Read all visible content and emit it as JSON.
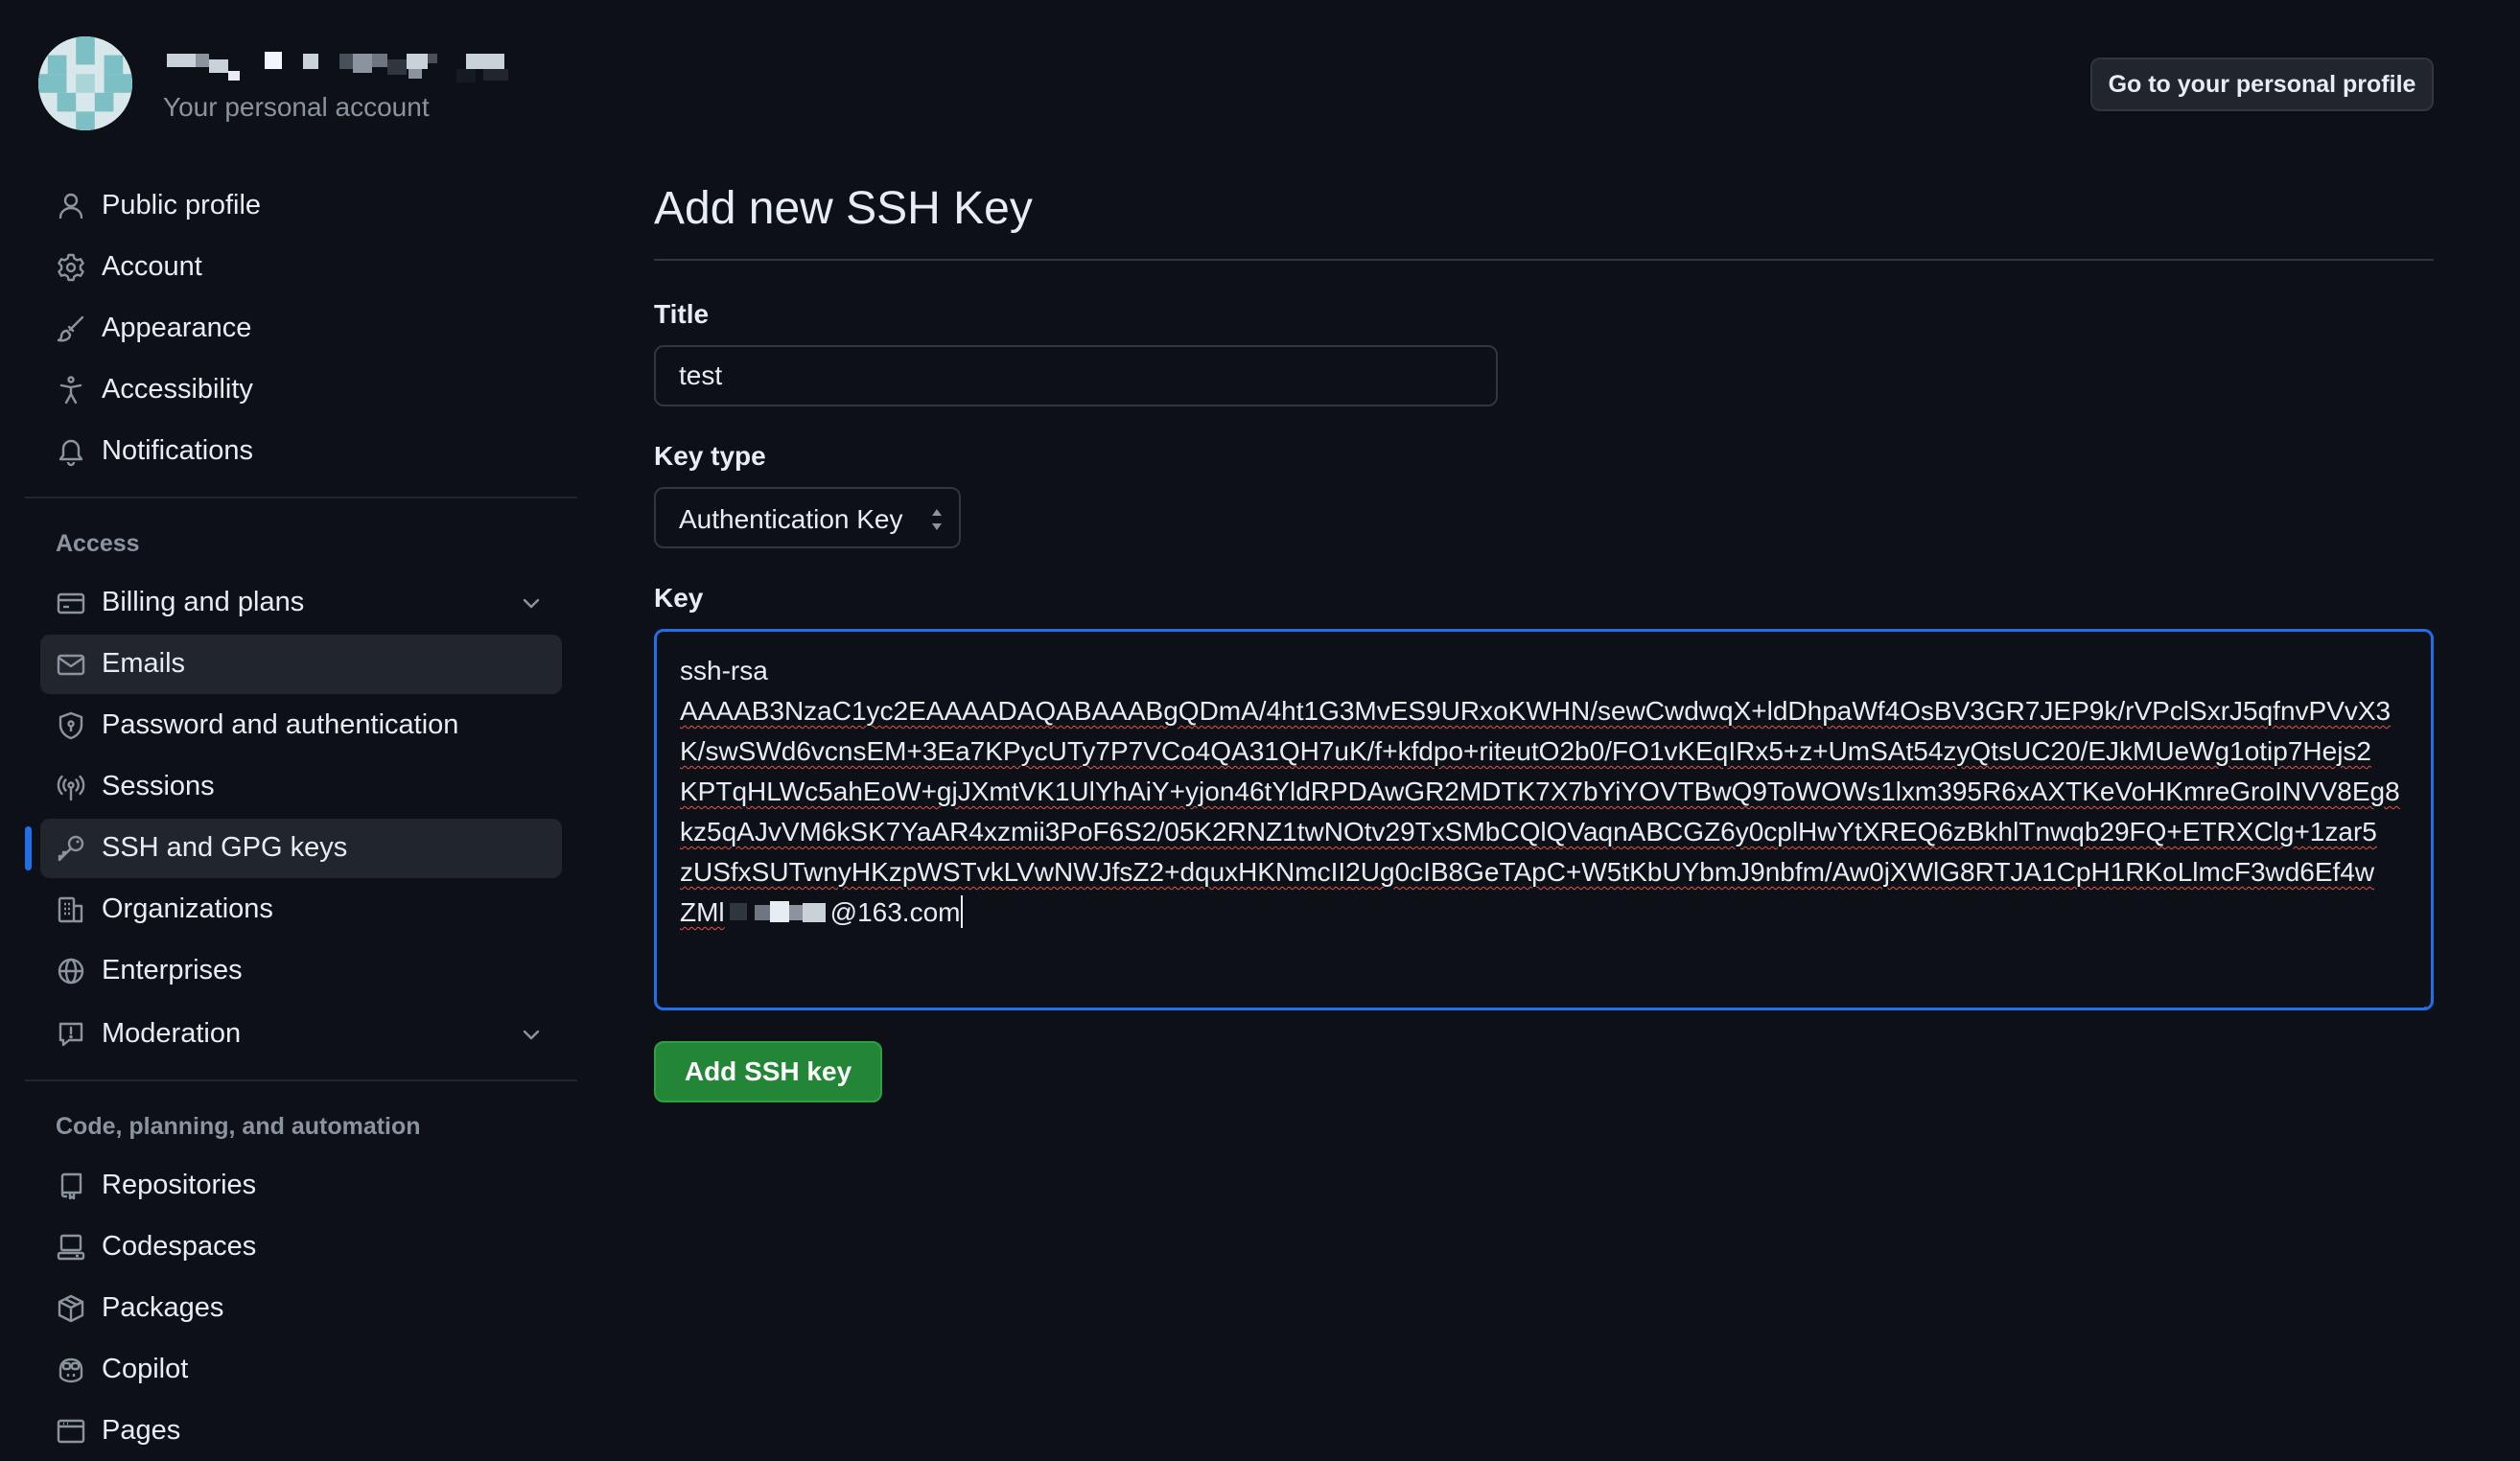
{
  "header": {
    "account_subtitle": "Your personal account",
    "profile_button": "Go to your personal profile"
  },
  "sidebar": {
    "items_top": [
      {
        "label": "Public profile",
        "icon": "person-icon"
      },
      {
        "label": "Account",
        "icon": "gear-icon"
      },
      {
        "label": "Appearance",
        "icon": "paintbrush-icon"
      },
      {
        "label": "Accessibility",
        "icon": "accessibility-icon"
      },
      {
        "label": "Notifications",
        "icon": "bell-icon"
      }
    ],
    "access_title": "Access",
    "access_items": [
      {
        "label": "Billing and plans",
        "icon": "credit-card-icon",
        "expandable": true
      },
      {
        "label": "Emails",
        "icon": "mail-icon"
      },
      {
        "label": "Password and authentication",
        "icon": "shield-lock-icon"
      },
      {
        "label": "Sessions",
        "icon": "broadcast-icon"
      },
      {
        "label": "SSH and GPG keys",
        "icon": "key-icon",
        "current": true
      },
      {
        "label": "Organizations",
        "icon": "organization-icon"
      },
      {
        "label": "Enterprises",
        "icon": "globe-icon"
      },
      {
        "label": "Moderation",
        "icon": "report-icon",
        "expandable": true
      }
    ],
    "code_title": "Code, planning, and automation",
    "code_items": [
      {
        "label": "Repositories",
        "icon": "repo-icon"
      },
      {
        "label": "Codespaces",
        "icon": "codespaces-icon"
      },
      {
        "label": "Packages",
        "icon": "package-icon"
      },
      {
        "label": "Copilot",
        "icon": "copilot-icon"
      },
      {
        "label": "Pages",
        "icon": "browser-icon"
      }
    ]
  },
  "main": {
    "title": "Add new SSH Key",
    "title_label": "Title",
    "title_value": "test",
    "key_type_label": "Key type",
    "key_type_value": "Authentication Key",
    "key_label": "Key",
    "key_lines": [
      "ssh-rsa",
      "AAAAB3NzaC1yc2EAAAADAQABAAABgQDmA/4ht1G3MvES9URxoKWHN/sewCwdwqX+ldDhpaWf4OsBV3GR7JEP9k/rVPclSxrJ5qfnvPVvX3",
      "K/swSWd6vcnsEM+3Ea7KPycUTy7P7VCo4QA31QH7uK/f+kfdpo+riteutO2b0/FO1vKEqIRx5+z+UmSAt54zyQtsUC20/EJkMUeWg1otip7Hejs2",
      "KPTqHLWc5ahEoW+gjJXmtVK1UlYhAiY+yjon46tYldRPDAwGR2MDTK7X7bYiYOVTBwQ9ToWOWs1lxm395R6xAXTKeVoHKmreGroINVV8Eg8",
      "kz5qAJvVM6kSK7YaAR4xzmii3PoF6S2/05K2RNZ1twNOtv29TxSMbCQlQVaqnABCGZ6y0cplHwYtXREQ6zBkhlTnwqb29FQ+ETRXClg+1zar5",
      "zUSfxSUTwnyHKzpWSTvkLVwNWJfsZ2+dquxHKNmcII2Ug0cIB8GeTApC+W5tKbUYbmJ9nbfm/Aw0jXWlG8RTJA1CpH1RKoLlmcF3wd6Ef4w"
    ],
    "key_last_prefix": "ZMl",
    "key_last_suffix": "@163.com",
    "submit_label": "Add SSH key"
  },
  "colors": {
    "background": "#0d1117",
    "accent_blue": "#1f6feb",
    "button_green": "#238636",
    "muted_text": "#8b949e"
  }
}
